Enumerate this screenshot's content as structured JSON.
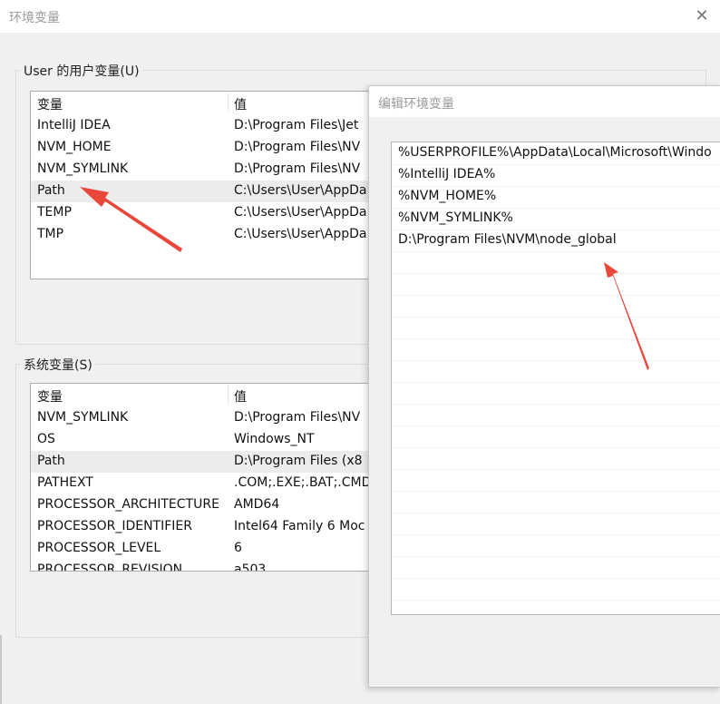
{
  "window": {
    "title": "环境变量",
    "close_icon": "close-icon"
  },
  "user_vars": {
    "group_label": "User 的用户变量(U)",
    "col_name": "变量",
    "col_value": "值",
    "rows": [
      {
        "name": "IntelliJ IDEA",
        "value": "D:\\Program Files\\Jet"
      },
      {
        "name": "NVM_HOME",
        "value": "D:\\Program Files\\NV"
      },
      {
        "name": "NVM_SYMLINK",
        "value": "D:\\Program Files\\NV"
      },
      {
        "name": "Path",
        "value": "C:\\Users\\User\\AppDa"
      },
      {
        "name": "TEMP",
        "value": "C:\\Users\\User\\AppDa"
      },
      {
        "name": "TMP",
        "value": "C:\\Users\\User\\AppDa"
      }
    ],
    "selected_row": "Path"
  },
  "system_vars": {
    "group_label": "系统变量(S)",
    "col_name": "变量",
    "col_value": "值",
    "rows": [
      {
        "name": "NVM_SYMLINK",
        "value": "D:\\Program Files\\NV"
      },
      {
        "name": "OS",
        "value": "Windows_NT"
      },
      {
        "name": "Path",
        "value": "D:\\Program Files (x8"
      },
      {
        "name": "PATHEXT",
        "value": ".COM;.EXE;.BAT;.CMD"
      },
      {
        "name": "PROCESSOR_ARCHITECTURE",
        "value": "AMD64"
      },
      {
        "name": "PROCESSOR_IDENTIFIER",
        "value": "Intel64 Family 6 Moc"
      },
      {
        "name": "PROCESSOR_LEVEL",
        "value": "6"
      },
      {
        "name": "PROCESSOR_REVISION",
        "value": "a503"
      }
    ],
    "selected_row": "Path"
  },
  "edit_dialog": {
    "title": "编辑环境变量",
    "entries": [
      "%USERPROFILE%\\AppData\\Local\\Microsoft\\Windo",
      "%IntelliJ IDEA%",
      "%NVM_HOME%",
      "%NVM_SYMLINK%",
      "D:\\Program Files\\NVM\\node_global"
    ]
  },
  "annotations": {
    "arrow_color": "#e8473a"
  }
}
